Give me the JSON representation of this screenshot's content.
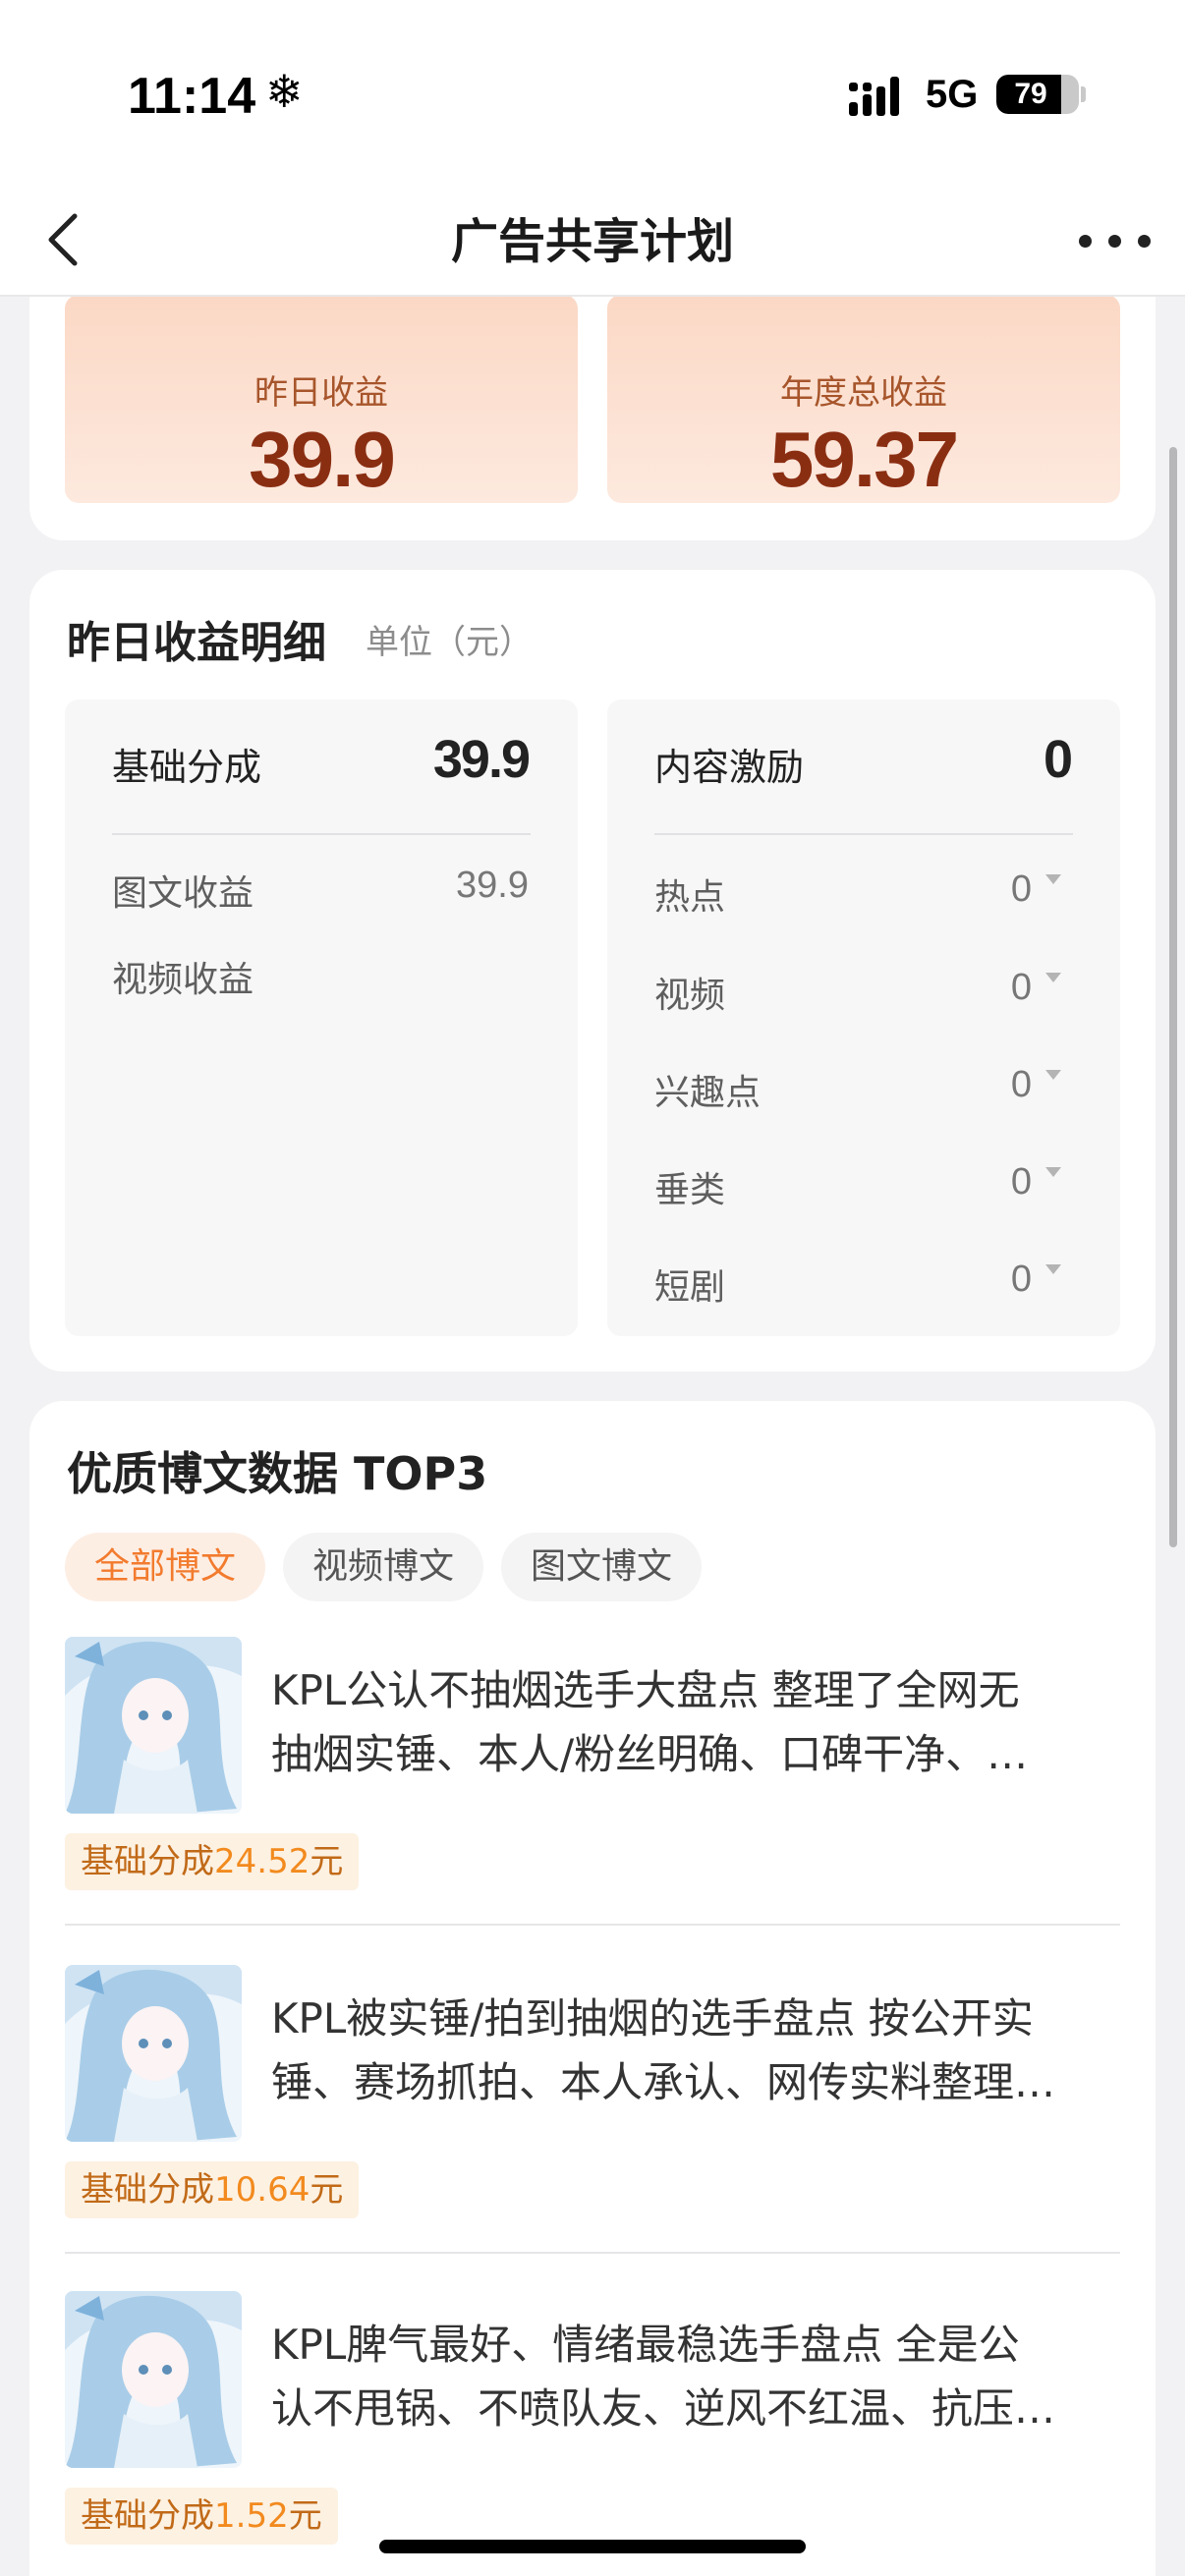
{
  "status_bar": {
    "time": "11:14",
    "time_icon": "snowflake-icon",
    "network": "5G",
    "battery_percent": 79
  },
  "nav": {
    "title": "广告共享计划",
    "back_icon": "chevron-left-icon",
    "more_icon": "more-dots-icon"
  },
  "summary": {
    "yesterday_label": "昨日收益",
    "yesterday_value": "39.9",
    "annual_label": "年度总收益",
    "annual_value": "59.37"
  },
  "detail": {
    "title": "昨日收益明细",
    "unit": "单位（元）",
    "base": {
      "label": "基础分成",
      "value": "39.9",
      "rows": [
        {
          "label": "图文收益",
          "value": "39.9"
        },
        {
          "label": "视频收益",
          "value": ""
        }
      ]
    },
    "incentive": {
      "label": "内容激励",
      "value": "0",
      "rows": [
        {
          "label": "热点",
          "value": "0"
        },
        {
          "label": "视频",
          "value": "0"
        },
        {
          "label": "兴趣点",
          "value": "0"
        },
        {
          "label": "垂类",
          "value": "0"
        },
        {
          "label": "短剧",
          "value": "0"
        }
      ]
    }
  },
  "posts": {
    "title": "优质博文数据 TOP3",
    "tabs": [
      {
        "label": "全部博文",
        "active": true
      },
      {
        "label": "视频博文",
        "active": false
      },
      {
        "label": "图文博文",
        "active": false
      }
    ],
    "items": [
      {
        "line1": "KPL公认不抽烟选手大盘点 整理了全网无",
        "line2": "抽烟实锤、本人/粉丝明确、口碑干净、…",
        "badge_prefix": "基础分成",
        "badge_amount": "24.52",
        "badge_unit": "元"
      },
      {
        "line1": "KPL被实锤/拍到抽烟的选手盘点 按公开实",
        "line2": "锤、赛场抓拍、本人承认、网传实料整理…",
        "badge_prefix": "基础分成",
        "badge_amount": "10.64",
        "badge_unit": "元"
      },
      {
        "line1": "KPL脾气最好、情绪最稳选手盘点 全是公",
        "line2": "认不甩锅、不喷队友、逆风不红温、抗压…",
        "badge_prefix": "基础分成",
        "badge_amount": "1.52",
        "badge_unit": "元"
      }
    ]
  }
}
